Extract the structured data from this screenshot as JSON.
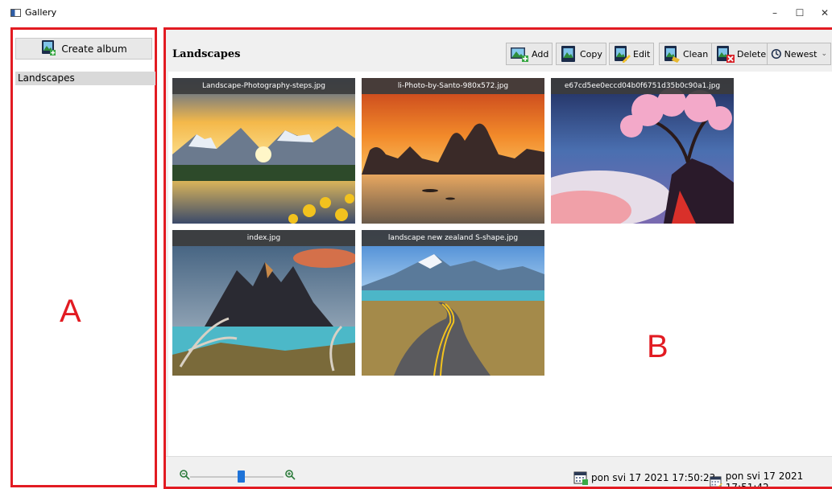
{
  "window": {
    "title": "Gallery",
    "minimize": "–",
    "maximize": "☐",
    "close": "✕"
  },
  "sidebar": {
    "create_album_label": "Create album",
    "albums": [
      {
        "label": "Landscapes"
      }
    ],
    "overlay_label": "A"
  },
  "main": {
    "album_title": "Landscapes",
    "overlay_label": "B",
    "toolbar": {
      "add_label": "Add",
      "copy_label": "Copy",
      "edit_label": "Edit",
      "clean_label": "Clean",
      "delete_label": "Delete",
      "sort_label": "Newest"
    },
    "images": [
      {
        "name": "Landscape-Photography-steps.jpg"
      },
      {
        "name": "li-Photo-by-Santo-980x572.jpg"
      },
      {
        "name": "e67cd5ee0eccd04b0f6751d35b0c90a1.jpg"
      },
      {
        "name": "index.jpg"
      },
      {
        "name": "landscape new zealand S-shape.jpg"
      }
    ]
  },
  "statusbar": {
    "zoom_level": 0.55,
    "created_date": "pon svi 17 2021 17:50:23",
    "modified_date": "pon svi 17 2021 17:51:42"
  },
  "colors": {
    "accent": "#e21b22",
    "slider": "#1e73d8"
  }
}
